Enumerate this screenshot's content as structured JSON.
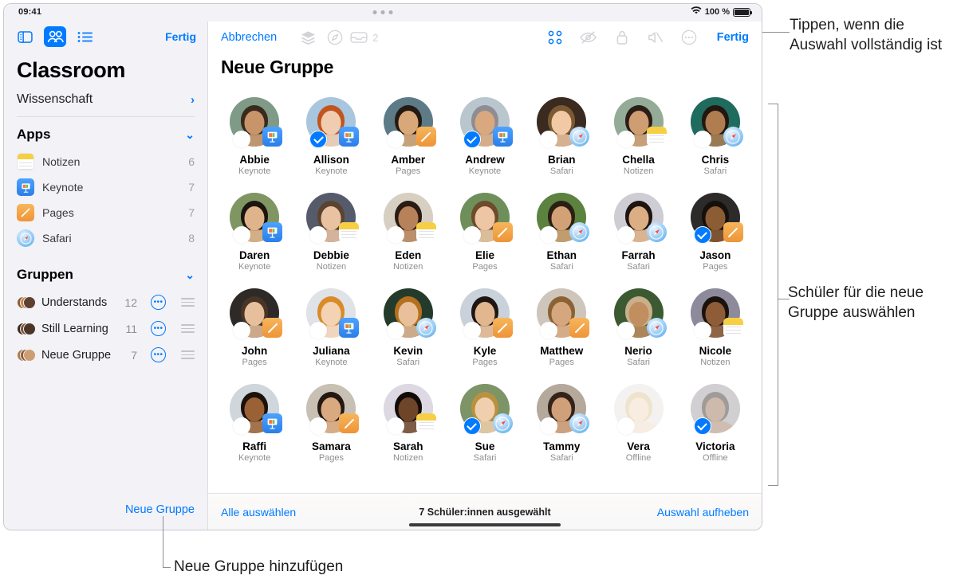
{
  "statusbar": {
    "clock": "09:41",
    "battery_label": "100 %",
    "wifi_icon": "wifi-icon",
    "battery_icon": "battery-icon"
  },
  "sidebar": {
    "toolbar": {
      "sidebar_toggle_icon": "sidebar-toggle-icon",
      "people_icon": "people-icon",
      "list_icon": "list-icon",
      "done_label": "Fertig"
    },
    "title": "Classroom",
    "class_name": "Wissenschaft",
    "apps_section": {
      "label": "Apps",
      "items": [
        {
          "name": "Notizen",
          "count": "6",
          "icon": "notes-app-icon"
        },
        {
          "name": "Keynote",
          "count": "7",
          "icon": "keynote-app-icon"
        },
        {
          "name": "Pages",
          "count": "7",
          "icon": "pages-app-icon"
        },
        {
          "name": "Safari",
          "count": "8",
          "icon": "safari-app-icon"
        }
      ]
    },
    "groups_section": {
      "label": "Gruppen",
      "items": [
        {
          "name": "Understands",
          "count": "12"
        },
        {
          "name": "Still Learning",
          "count": "11"
        },
        {
          "name": "Neue Gruppe",
          "count": "7"
        }
      ]
    },
    "new_group_label": "Neue Gruppe"
  },
  "main": {
    "toolbar": {
      "cancel_label": "Abbrechen",
      "layers_icon": "layers-icon",
      "navigate_icon": "navigate-compass-icon",
      "inbox_icon": "inbox-icon",
      "inbox_count": "2",
      "grid_icon": "grid-view-icon",
      "hide_icon": "eye-slash-icon",
      "lock_icon": "lock-icon",
      "mute_icon": "mute-icon",
      "more_icon": "more-circle-icon",
      "done_label": "Fertig"
    },
    "title": "Neue Gruppe",
    "students": [
      {
        "name": "Abbie",
        "app": "Keynote",
        "selected": false,
        "offline": false,
        "skin": "#c8956b",
        "hair": "#3a2a1e",
        "bg": "#7f9a86"
      },
      {
        "name": "Allison",
        "app": "Keynote",
        "selected": true,
        "offline": false,
        "skin": "#f0cdb0",
        "hair": "#c1541f",
        "bg": "#a8c6dd"
      },
      {
        "name": "Amber",
        "app": "Pages",
        "selected": false,
        "offline": false,
        "skin": "#d9a878",
        "hair": "#241a14",
        "bg": "#5d7b86"
      },
      {
        "name": "Andrew",
        "app": "Keynote",
        "selected": true,
        "offline": false,
        "skin": "#d9a87f",
        "hair": "#8d8d93",
        "bg": "#b9c6ce"
      },
      {
        "name": "Brian",
        "app": "Safari",
        "selected": false,
        "offline": false,
        "skin": "#f1c9a5",
        "hair": "#7b5a33",
        "bg": "#3b2a1f"
      },
      {
        "name": "Chella",
        "app": "Notizen",
        "selected": false,
        "offline": false,
        "skin": "#cf9d72",
        "hair": "#2b1d16",
        "bg": "#93ab97"
      },
      {
        "name": "Chris",
        "app": "Safari",
        "selected": false,
        "offline": false,
        "skin": "#b07d50",
        "hair": "#231710",
        "bg": "#1f6b5e"
      },
      {
        "name": "Daren",
        "app": "Keynote",
        "selected": false,
        "offline": false,
        "skin": "#e0b48b",
        "hair": "#1c1410",
        "bg": "#7f9663"
      },
      {
        "name": "Debbie",
        "app": "Notizen",
        "selected": false,
        "offline": false,
        "skin": "#e9c3a1",
        "hair": "#5b4330",
        "bg": "#565b6b"
      },
      {
        "name": "Eden",
        "app": "Notizen",
        "selected": false,
        "offline": false,
        "skin": "#b7825a",
        "hair": "#2a1b13",
        "bg": "#d7cfc2"
      },
      {
        "name": "Elie",
        "app": "Pages",
        "selected": false,
        "offline": false,
        "skin": "#eec5a5",
        "hair": "#6d4b2c",
        "bg": "#6f8f5a"
      },
      {
        "name": "Ethan",
        "app": "Safari",
        "selected": false,
        "offline": false,
        "skin": "#d2a276",
        "hair": "#2d1e14",
        "bg": "#5c8240"
      },
      {
        "name": "Farrah",
        "app": "Safari",
        "selected": false,
        "offline": false,
        "skin": "#dcae84",
        "hair": "#1e1410",
        "bg": "#cfcdd4"
      },
      {
        "name": "Jason",
        "app": "Pages",
        "selected": true,
        "offline": false,
        "skin": "#8c5c35",
        "hair": "#16100b",
        "bg": "#2c2b2a"
      },
      {
        "name": "John",
        "app": "Pages",
        "selected": false,
        "offline": false,
        "skin": "#e8bf9c",
        "hair": "#4a3525",
        "bg": "#2e2a27"
      },
      {
        "name": "Juliana",
        "app": "Keynote",
        "selected": false,
        "offline": false,
        "skin": "#f4d2b4",
        "hair": "#d98b2a",
        "bg": "#dfe3e7"
      },
      {
        "name": "Kevin",
        "app": "Safari",
        "selected": false,
        "offline": false,
        "skin": "#e9c09a",
        "hair": "#b4701f",
        "bg": "#243b2c"
      },
      {
        "name": "Kyle",
        "app": "Pages",
        "selected": false,
        "offline": false,
        "skin": "#e2b68f",
        "hair": "#1d1612",
        "bg": "#c9d2da"
      },
      {
        "name": "Matthew",
        "app": "Pages",
        "selected": false,
        "offline": false,
        "skin": "#d5a77e",
        "hair": "#8a6233",
        "bg": "#cfc6bb"
      },
      {
        "name": "Nerio",
        "app": "Safari",
        "selected": false,
        "offline": false,
        "skin": "#c08e5f",
        "hair": "#c9b08c",
        "bg": "#3c5a32"
      },
      {
        "name": "Nicole",
        "app": "Notizen",
        "selected": false,
        "offline": false,
        "skin": "#8e5c37",
        "hair": "#1a120d",
        "bg": "#8d8a9b"
      },
      {
        "name": "Raffi",
        "app": "Keynote",
        "selected": false,
        "offline": false,
        "skin": "#9a6134",
        "hair": "#1b120c",
        "bg": "#cfd6dc"
      },
      {
        "name": "Samara",
        "app": "Pages",
        "selected": false,
        "offline": false,
        "skin": "#d9a97f",
        "hair": "#241812",
        "bg": "#c8c0b2"
      },
      {
        "name": "Sarah",
        "app": "Notizen",
        "selected": false,
        "offline": false,
        "skin": "#6f452a",
        "hair": "#120c09",
        "bg": "#ddd9e2"
      },
      {
        "name": "Sue",
        "app": "Safari",
        "selected": true,
        "offline": false,
        "skin": "#f0cfae",
        "hair": "#b9913f",
        "bg": "#7d9467"
      },
      {
        "name": "Tammy",
        "app": "Safari",
        "selected": false,
        "offline": false,
        "skin": "#cfa079",
        "hair": "#33231a",
        "bg": "#b5a99b"
      },
      {
        "name": "Vera",
        "app": "Offline",
        "selected": false,
        "offline": true,
        "skin": "#f1d2b6",
        "hair": "#d8c08c",
        "bg": "#e4e1dc"
      },
      {
        "name": "Victoria",
        "app": "Offline",
        "selected": true,
        "offline": true,
        "skin": "#8d5d3b",
        "hair": "#1d130d",
        "bg": "#938e96"
      }
    ],
    "bottom_bar": {
      "select_all_label": "Alle auswählen",
      "status_label": "7 Schüler:innen ausgewählt",
      "deselect_label": "Auswahl aufheben"
    }
  },
  "annotations": {
    "top_right": "Tippen, wenn die Auswahl vollständig ist",
    "middle_right": "Schüler für die neue Gruppe auswählen",
    "bottom": "Neue Gruppe hinzufügen"
  }
}
